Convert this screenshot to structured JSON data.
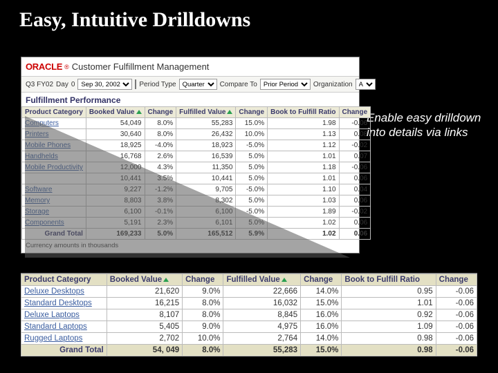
{
  "slide": {
    "title": "Easy, Intuitive Drilldowns",
    "callout": "Enable easy drilldown into details via links"
  },
  "app": {
    "brand": "ORACLE",
    "title": "Customer Fulfillment Management",
    "filter": {
      "prefix": "Q3 FY02",
      "day_lbl": "Day",
      "day": "0",
      "date": "Sep 30, 2002",
      "period_lbl": "Period Type",
      "period": "Quarter",
      "compare_lbl": "Compare To",
      "compare": "Prior Period",
      "org_lbl": "Organization",
      "org": "A"
    },
    "section": "Fulfillment Performance",
    "columns": {
      "c0": "Product Category",
      "c1": "Booked Value",
      "c2": "Change",
      "c3": "Fulfilled Value",
      "c4": "Change",
      "c5": "Book to Fulfill Ratio",
      "c6": "Change"
    },
    "rows": [
      {
        "cat": "Computers",
        "bv": "54,049",
        "bvc": "8.0%",
        "fv": "55,283",
        "fvc": "15.0%",
        "r": "1.98",
        "rc": "-0.06"
      },
      {
        "cat": "Printers",
        "bv": "30,640",
        "bvc": "8.0%",
        "fv": "26,432",
        "fvc": "10.0%",
        "r": "1.13",
        "rc": "0.08"
      },
      {
        "cat": "Mobile Phones",
        "bv": "18,925",
        "bvc": "-4.0%",
        "fv": "18,923",
        "fvc": "-5.0%",
        "r": "1.12",
        "rc": "-0.02"
      },
      {
        "cat": "Handhelds",
        "bv": "16,768",
        "bvc": "2.6%",
        "fv": "16,539",
        "fvc": "5.0%",
        "r": "1.01",
        "rc": "0.07"
      },
      {
        "cat": "Mobile Productivity",
        "bv": "12,000",
        "bvc": "4.3%",
        "fv": "11,350",
        "fvc": "5.0%",
        "r": "1.18",
        "rc": "-0.06"
      },
      {
        "cat": "",
        "bv": "10,441",
        "bvc": "3.5%",
        "fv": "10,441",
        "fvc": "5.0%",
        "r": "1.01",
        "rc": "0.06"
      },
      {
        "cat": "Software",
        "bv": "9,227",
        "bvc": "-1.2%",
        "fv": "9,705",
        "fvc": "-5.0%",
        "r": "1.10",
        "rc": "0.04"
      },
      {
        "cat": "Memory",
        "bv": "8,803",
        "bvc": "3.8%",
        "fv": "8,302",
        "fvc": "5.0%",
        "r": "1.03",
        "rc": "0.06"
      },
      {
        "cat": "Storage",
        "bv": "6,100",
        "bvc": "-0.1%",
        "fv": "6,100",
        "fvc": "-5.0%",
        "r": "1.89",
        "rc": "-0.02"
      },
      {
        "cat": "Components",
        "bv": "5,191",
        "bvc": "2.3%",
        "fv": "6,101",
        "fvc": "5.0%",
        "r": "1.02",
        "rc": "0.06"
      }
    ],
    "total": {
      "cat": "Grand Total",
      "bv": "169,233",
      "bvc": "5.0%",
      "fv": "165,512",
      "fvc": "5.9%",
      "r": "1.02",
      "rc": "0.06"
    },
    "footnote": "Currency amounts in thousands"
  },
  "drill": {
    "columns": {
      "c0": "Product Category",
      "c1": "Booked Value",
      "c2": "Change",
      "c3": "Fulfilled Value",
      "c4": "Change",
      "c5": "Book to Fulfill Ratio",
      "c6": "Change"
    },
    "rows": [
      {
        "cat": "Deluxe Desktops",
        "bv": "21,620",
        "bvc": "9.0%",
        "fv": "22,666",
        "fvc": "14.0%",
        "r": "0.95",
        "rc": "-0.06"
      },
      {
        "cat": "Standard Desktops",
        "bv": "16,215",
        "bvc": "8.0%",
        "fv": "16,032",
        "fvc": "15.0%",
        "r": "1.01",
        "rc": "-0.06"
      },
      {
        "cat": "Deluxe Laptops",
        "bv": "8,107",
        "bvc": "8.0%",
        "fv": "8,845",
        "fvc": "16.0%",
        "r": "0.92",
        "rc": "-0.06"
      },
      {
        "cat": "Standard Laptops",
        "bv": "5,405",
        "bvc": "9.0%",
        "fv": "4,975",
        "fvc": "16.0%",
        "r": "1.09",
        "rc": "-0.06"
      },
      {
        "cat": "Rugged Laptops",
        "bv": "2,702",
        "bvc": "10.0%",
        "fv": "2,764",
        "fvc": "14.0%",
        "r": "0.98",
        "rc": "-0.06"
      }
    ],
    "total": {
      "cat": "Grand Total",
      "bv": "54, 049",
      "bvc": "8.0%",
      "fv": "55,283",
      "fvc": "15.0%",
      "r": "0.98",
      "rc": "-0.06"
    }
  }
}
